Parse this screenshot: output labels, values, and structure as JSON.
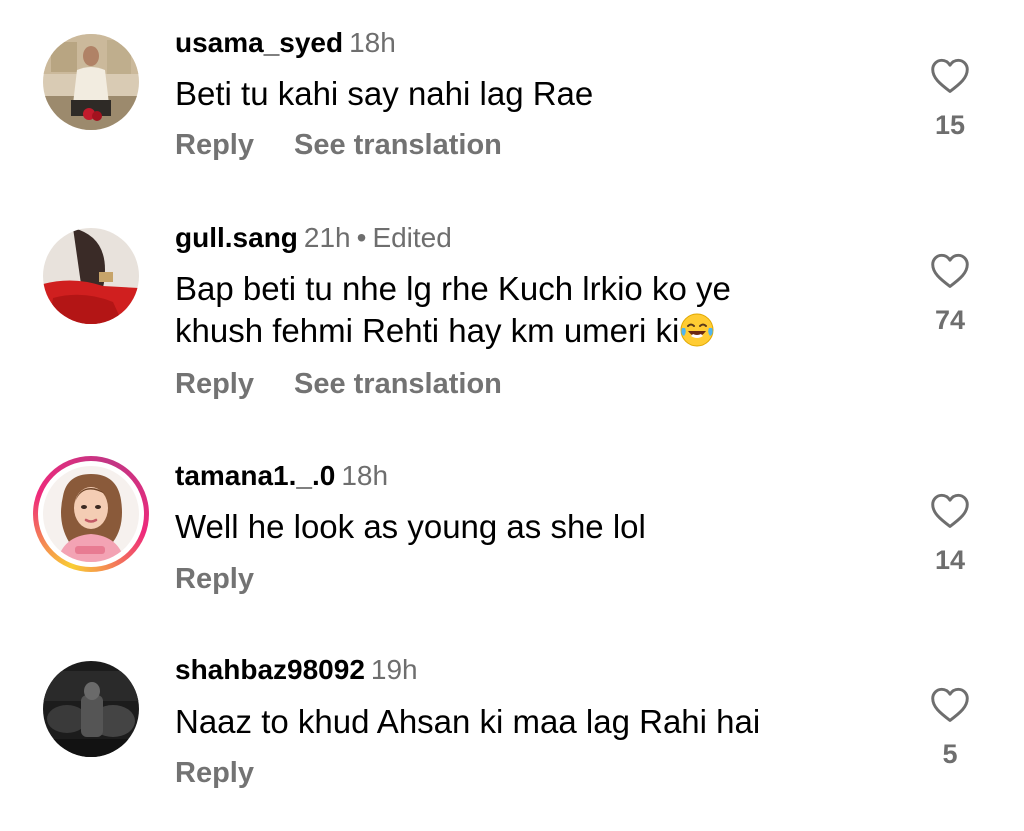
{
  "comments": [
    {
      "username": "usama_syed",
      "time": "18h",
      "edited": "",
      "text": "Beti tu kahi say nahi lag Rae",
      "text_line2": "",
      "emoji": "",
      "reply_label": "Reply",
      "translate_label": "See translation",
      "likes": "15",
      "has_story_ring": false
    },
    {
      "username": "gull.sang",
      "time": "21h",
      "edited": "Edited",
      "text": "Bap beti tu nhe lg rhe Kuch lrkio ko ye",
      "text_line2": "khush fehmi Rehti hay km umeri ki",
      "emoji": "face-with-tears-of-joy",
      "reply_label": "Reply",
      "translate_label": "See translation",
      "likes": "74",
      "has_story_ring": false
    },
    {
      "username": "tamana1._.0",
      "time": "18h",
      "edited": "",
      "text": "Well he look as young as she lol",
      "text_line2": "",
      "emoji": "",
      "reply_label": "Reply",
      "translate_label": "",
      "likes": "14",
      "has_story_ring": true
    },
    {
      "username": "shahbaz98092",
      "time": "19h",
      "edited": "",
      "text": "Naaz to khud Ahsan ki maa lag Rahi hai",
      "text_line2": "",
      "emoji": "",
      "reply_label": "Reply",
      "translate_label": "",
      "likes": "5",
      "has_story_ring": false
    }
  ],
  "colors": {
    "primary_text": "#000000",
    "secondary_text": "#737373",
    "story_ring_start": "#f9ce34",
    "story_ring_end": "#ee2a7b"
  },
  "icons": {
    "like": "heart-outline-icon",
    "emoji": "face-with-tears-of-joy"
  }
}
